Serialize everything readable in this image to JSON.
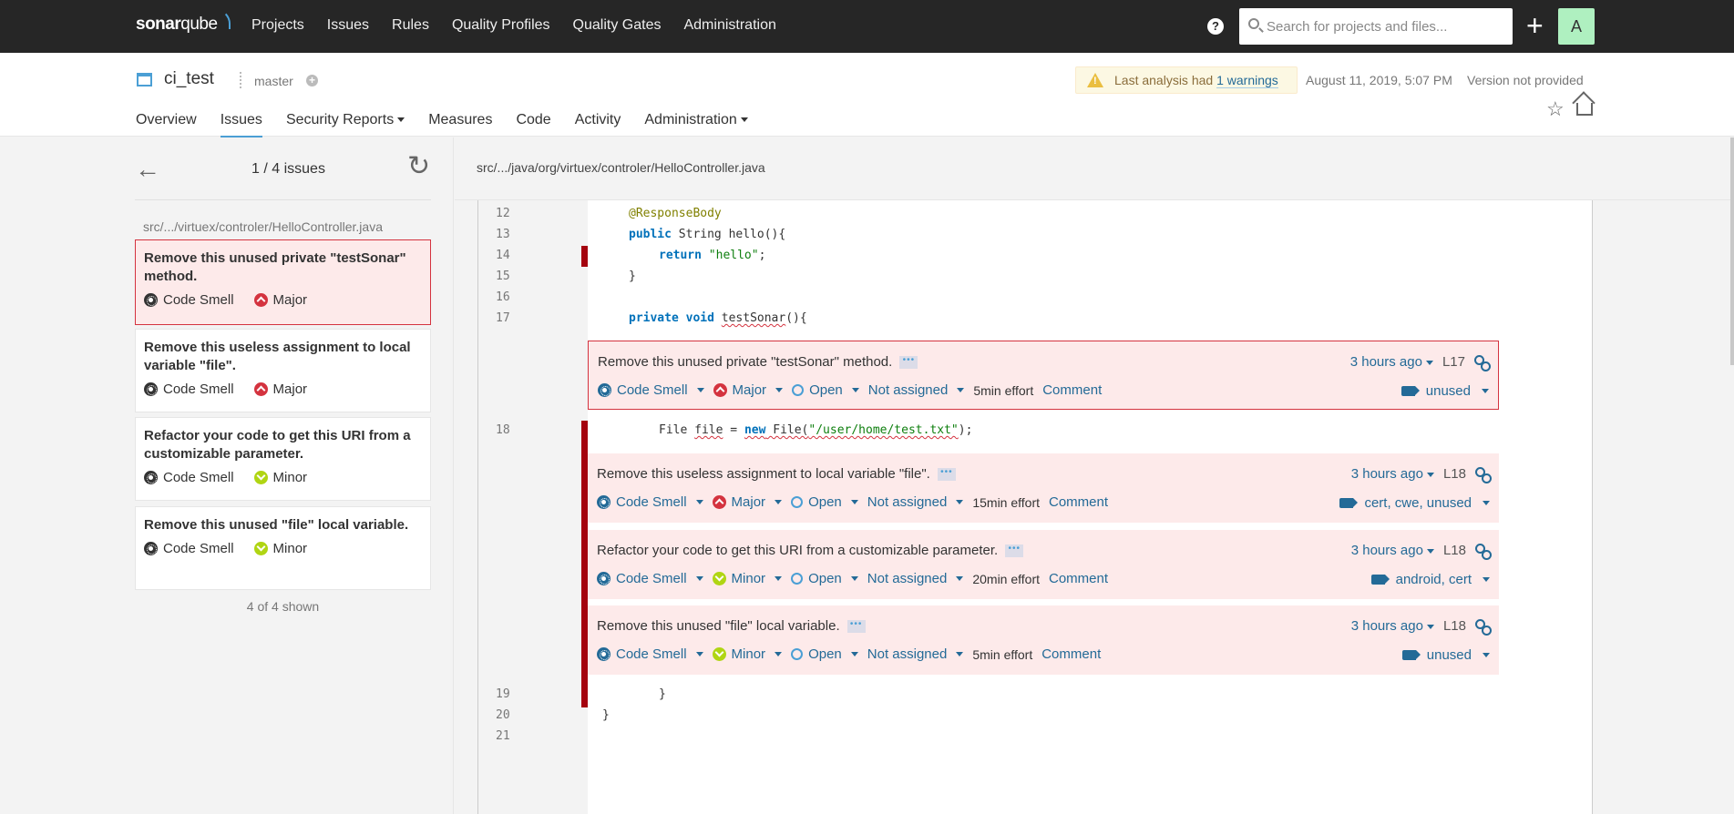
{
  "navbar": {
    "logo_bold": "sonar",
    "logo_light": "qube",
    "links": [
      "Projects",
      "Issues",
      "Rules",
      "Quality Profiles",
      "Quality Gates",
      "Administration"
    ],
    "help_icon": "?",
    "search_placeholder": "Search for projects and files...",
    "plus_icon": "+",
    "avatar_letter": "A"
  },
  "project": {
    "name": "ci_test",
    "branch": "master",
    "warning_prefix": "Last analysis had ",
    "warning_link": "1 warnings",
    "analysis_date": "August 11, 2019, 5:07 PM",
    "version": "Version not provided",
    "favorite_icon": "☆",
    "tabs": [
      {
        "label": "Overview",
        "active": false,
        "dropdown": false
      },
      {
        "label": "Issues",
        "active": true,
        "dropdown": false
      },
      {
        "label": "Security Reports",
        "active": false,
        "dropdown": true
      },
      {
        "label": "Measures",
        "active": false,
        "dropdown": false
      },
      {
        "label": "Code",
        "active": false,
        "dropdown": false
      },
      {
        "label": "Activity",
        "active": false,
        "dropdown": false
      },
      {
        "label": "Administration",
        "active": false,
        "dropdown": true
      }
    ]
  },
  "issue_list": {
    "back_icon": "←",
    "counter_current": "1",
    "counter_sep": " / ",
    "counter_total": "4",
    "counter_suffix": " issues",
    "reload_icon": "↻",
    "file": "src/.../virtuex/controler/HelloController.java",
    "items": [
      {
        "title": "Remove this unused private \"testSonar\" method.",
        "type": "Code Smell",
        "severity": "Major",
        "selected": true
      },
      {
        "title": "Remove this useless assignment to local variable \"file\".",
        "type": "Code Smell",
        "severity": "Major",
        "selected": false
      },
      {
        "title": "Refactor your code to get this URI from a customizable parameter.",
        "type": "Code Smell",
        "severity": "Minor",
        "selected": false
      },
      {
        "title": "Remove this unused \"file\" local variable.",
        "type": "Code Smell",
        "severity": "Minor",
        "selected": false
      }
    ],
    "shown": "4 of 4 shown"
  },
  "viewer": {
    "file_path": "src/.../java/org/virtuex/controler/HelloController.java",
    "lines": {
      "12": "@ResponseBody",
      "13_kw": "public",
      "13_rest": " String hello(){",
      "14_kw": "return",
      "14_str": "\"hello\"",
      "14_end": ";",
      "15": "}",
      "16": "",
      "17_kw1": "private",
      "17_kw2": "void",
      "17_name": "testSonar",
      "17_end": "(){",
      "18_a": "File ",
      "18_var": "file",
      "18_b": " = ",
      "18_kw": "new",
      "18_c": " File(",
      "18_str": "\"/user/home/test.txt\"",
      "18_end": ");",
      "19": "}",
      "20": "}",
      "21": ""
    },
    "line_numbers": [
      "12",
      "13",
      "14",
      "15",
      "16",
      "17",
      "18",
      "19",
      "20",
      "21"
    ],
    "issues": [
      {
        "message": "Remove this unused private \"testSonar\" method.",
        "more": "•••",
        "type": "Code Smell",
        "severity": "Major",
        "status": "Open",
        "assignee": "Not assigned",
        "effort": "5min effort",
        "comment": "Comment",
        "date": "3 hours ago",
        "line": "L17",
        "tags": "unused",
        "selected": true
      },
      {
        "message": "Remove this useless assignment to local variable \"file\".",
        "more": "•••",
        "type": "Code Smell",
        "severity": "Major",
        "status": "Open",
        "assignee": "Not assigned",
        "effort": "15min effort",
        "comment": "Comment",
        "date": "3 hours ago",
        "line": "L18",
        "tags": "cert, cwe, unused",
        "selected": false
      },
      {
        "message": "Refactor your code to get this URI from a customizable parameter.",
        "more": "•••",
        "type": "Code Smell",
        "severity": "Minor",
        "status": "Open",
        "assignee": "Not assigned",
        "effort": "20min effort",
        "comment": "Comment",
        "date": "3 hours ago",
        "line": "L18",
        "tags": "android, cert",
        "selected": false
      },
      {
        "message": "Remove this unused \"file\" local variable.",
        "more": "•••",
        "type": "Code Smell",
        "severity": "Minor",
        "status": "Open",
        "assignee": "Not assigned",
        "effort": "5min effort",
        "comment": "Comment",
        "date": "3 hours ago",
        "line": "L18",
        "tags": "unused",
        "selected": false
      }
    ]
  },
  "colors": {
    "navbar_bg": "#262626",
    "accent_blue": "#4b9fd5",
    "link_blue": "#236a97",
    "major_red": "#d4333f",
    "minor_green": "#b0d513",
    "issue_bg": "#fdeaea",
    "issue_marker": "#a4030f",
    "avatar_bg": "#aff0c0"
  }
}
